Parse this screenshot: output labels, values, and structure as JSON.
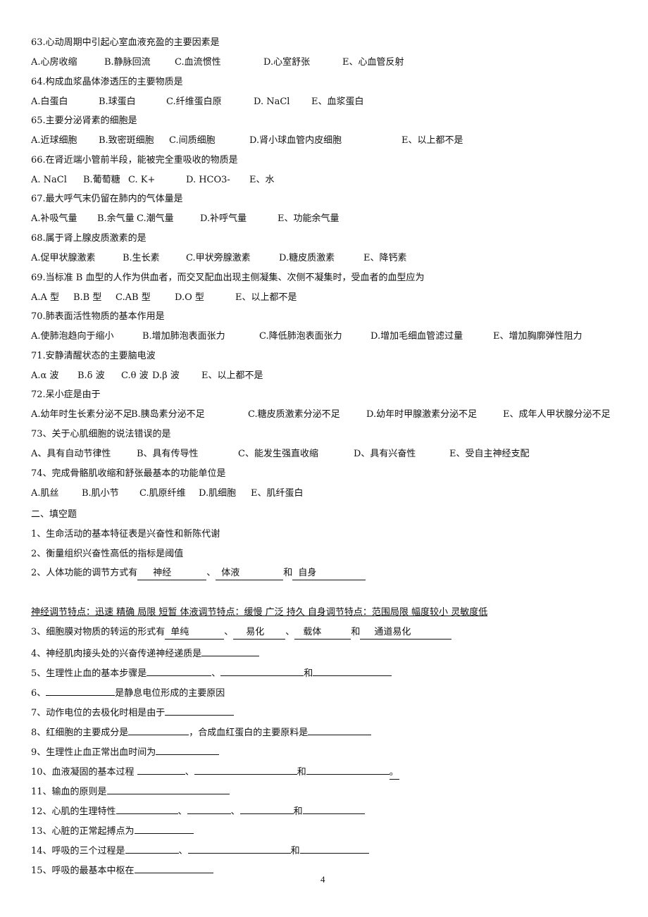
{
  "questions": [
    {
      "stem": "63.心动周期中引起心室血液充盈的主要因素是",
      "options": [
        "A.心房收缩",
        "B.静脉回流",
        "C.血流惯性",
        "D.心室舒张",
        "E、心血管反射"
      ]
    },
    {
      "stem": "64.构成血浆晶体渗透压的主要物质是",
      "options": [
        "A.白蛋白",
        "B.球蛋白",
        "C.纤维蛋白原",
        "D. NaCl",
        "E、血浆蛋白"
      ]
    },
    {
      "stem": "65.主要分泌肾素的细胞是",
      "options": [
        "A.近球细胞",
        "B.致密斑细胞",
        "C.间质细胞",
        "D.肾小球血管内皮细胞",
        "E、以上都不是"
      ]
    },
    {
      "stem": "66.在肾近端小管前半段，能被完全重吸收的物质是",
      "options": [
        "A. NaCl",
        "B.葡萄糖",
        "C. K+",
        "D. HCO3-",
        "E、水"
      ]
    },
    {
      "stem": "67.最大呼气末仍留在肺内的气体量是",
      "options": [
        "A.补吸气量",
        "B.余气量",
        "C.潮气量",
        "D.补呼气量",
        "E、功能余气量"
      ]
    },
    {
      "stem": "68.属于肾上腺皮质激素的是",
      "options": [
        "A.促甲状腺激素",
        "B.生长素",
        "C.甲状旁腺激素",
        "D.糖皮质激素",
        "E、降钙素"
      ]
    },
    {
      "stem": "69.当标准 B 血型的人作为供血者，而交叉配血出现主侧凝集、次侧不凝集时，受血者的血型应为",
      "options": [
        "A.A 型",
        "B.B 型",
        "C.AB 型",
        "D.O 型",
        "E、以上都不是"
      ]
    },
    {
      "stem": "70.肺表面活性物质的基本作用是",
      "options": [
        "A.使肺泡趋向于缩小",
        "B.增加肺泡表面张力",
        "C.降低肺泡表面张力",
        "D.增加毛细血管滤过量",
        "E、增加胸廓弹性阻力"
      ]
    },
    {
      "stem": "71.安静清醒状态的主要脑电波",
      "options": [
        "A.α 波",
        "B.δ 波",
        "C.θ 波",
        "D.β 波",
        "E、以上都不是"
      ]
    },
    {
      "stem": "72.呆小症是由于",
      "options": [
        "A.幼年时生长素分泌不足",
        "B.胰岛素分泌不足",
        "C.糖皮质激素分泌不足",
        "D.幼年时甲腺激素分泌不足",
        "E、成年人甲状腺分泌不足"
      ]
    },
    {
      "stem": "73、关于心肌细胞的说法错误的是",
      "options": [
        "A、具有自动节律性",
        "B、具有传导性",
        "C、能发生强直收缩",
        "D、具有兴奋性",
        "E、受自主神经支配"
      ]
    },
    {
      "stem": "74、完成骨骼肌收缩和舒张最基本的功能单位是",
      "options": [
        "A.肌丝",
        "B.肌小节",
        "C.肌原纤维",
        "D.肌细胞",
        "E、肌纤蛋白"
      ]
    }
  ],
  "fill": {
    "section_title": "二、填空题",
    "q1": "1、生命活动的基本特征表是兴奋性和新陈代谢",
    "q2a": "2、衡量组织兴奋性高低的指标是阈值",
    "q2b": {
      "prefix": "2、人体功能的调节方式有",
      "a1": "神经",
      "sep1": "、",
      "a2": "体液",
      "sep2": "和",
      "a3": "自身"
    },
    "note": "神经调节特点：迅速  精确  局限  短暂     体液调节特点：缓慢  广泛  持久    自身调节特点：范围局限  幅度较小  灵敏度低",
    "q3": {
      "prefix": "3、细胞膜对物质的转运的形式有",
      "a1": "单纯",
      "sep1": "、",
      "a2": "易化",
      "sep2": "、",
      "a3": "载体",
      "sep3": "和",
      "a4": "通道易化"
    },
    "q4": "4、神经肌肉接头处的兴奋传递神经递质是",
    "q5": {
      "prefix": "5、生理性止血的基本步骤是",
      "sep1": "、",
      "sep2": "和"
    },
    "q6": {
      "prefix": "6、",
      "suffix": "是静息电位形成的主要原因"
    },
    "q7": "7、动作电位的去极化时相是由于",
    "q8": {
      "prefix": "8、红细胞的主要成分是",
      "mid": "，合成血红蛋白的主要原料是"
    },
    "q9": "9、生理性止血正常出血时间为",
    "q10": {
      "prefix": "10、血液凝固的基本过程 ",
      "sep1": "、",
      "sep2": "和",
      "end": "。"
    },
    "q11": "11、输血的原则是",
    "q12": {
      "prefix": "12、心肌的生理特性",
      "sep1": "、",
      "sep2": "、",
      "sep3": "和"
    },
    "q13": "13、心脏的正常起搏点为",
    "q14": {
      "prefix": "14、呼吸的三个过程是",
      "sep1": "、",
      "sep2": "和"
    },
    "q15": "15、呼吸的最基本中枢在"
  },
  "page_number": "4"
}
